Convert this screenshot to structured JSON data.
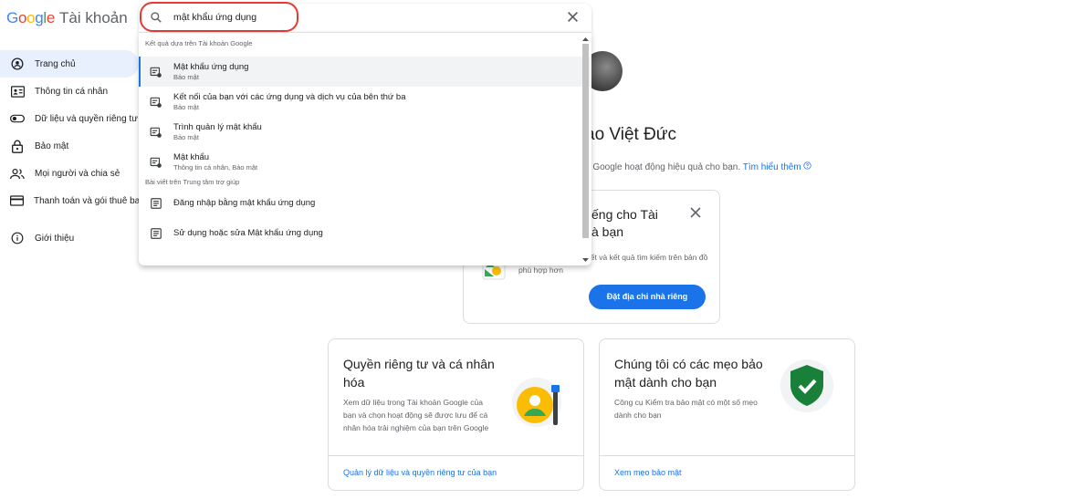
{
  "logo": {
    "google": "Google",
    "product": "Tài khoản"
  },
  "sidebar": {
    "items": [
      {
        "label": "Trang chủ"
      },
      {
        "label": "Thông tin cá nhân"
      },
      {
        "label": "Dữ liệu và quyền riêng tư"
      },
      {
        "label": "Bảo mật"
      },
      {
        "label": "Mọi người và chia sẻ"
      },
      {
        "label": "Thanh toán và gói thuê ba"
      },
      {
        "label": "Giới thiệu"
      }
    ]
  },
  "search": {
    "query": "mật khẩu ứng dụng",
    "section_account": "Kết quả dựa trên Tài khoản Google",
    "account_results": [
      {
        "title": "Mật khẩu ứng dụng",
        "sub": "Bảo mật"
      },
      {
        "title": "Kết nối của bạn với các ứng dụng và dịch vụ của bên thứ ba",
        "sub": "Bảo mật"
      },
      {
        "title": "Trình quản lý mật khẩu",
        "sub": "Bảo mật"
      },
      {
        "title": "Mật khẩu",
        "sub": "Thông tin cá nhân, Bảo mật"
      }
    ],
    "section_help": "Bài viết trên Trung tâm trợ giúp",
    "help_results": [
      {
        "title": "Đăng nhập bằng mật khẩu ứng dụng"
      },
      {
        "title": "Sử dụng hoặc sửa Mật khẩu ứng dụng"
      }
    ]
  },
  "main": {
    "greeting": "ảo Việt Đức",
    "intro": "ế Google hoạt động hiệu quả cho bạn.",
    "learn_more": "Tìm hiểu thêm",
    "home_card": {
      "title": "ếng cho Tài\nà bạn",
      "desc": "kiếm, thông tin thời tiết và kết quả tìm kiếm trên bản đồ phù hợp hơn",
      "button": "Đặt địa chỉ nhà riêng"
    },
    "privacy_card": {
      "title": "Quyền riêng tư và cá nhân hóa",
      "desc": "Xem dữ liệu trong Tài khoản Google của bạn và chọn hoạt động sẽ được lưu để cá nhân hóa trải nghiệm của bạn trên Google",
      "link": "Quản lý dữ liệu và quyền riêng tư của bạn"
    },
    "security_card": {
      "title": "Chúng tôi có các mẹo bảo mật dành cho bạn",
      "desc": "Công cụ Kiểm tra bảo mật có một số mẹo dành cho bạn",
      "link": "Xem mẹo bảo mật"
    }
  },
  "colors": {
    "accent": "#1a73e8",
    "highlight": "#e53935"
  }
}
